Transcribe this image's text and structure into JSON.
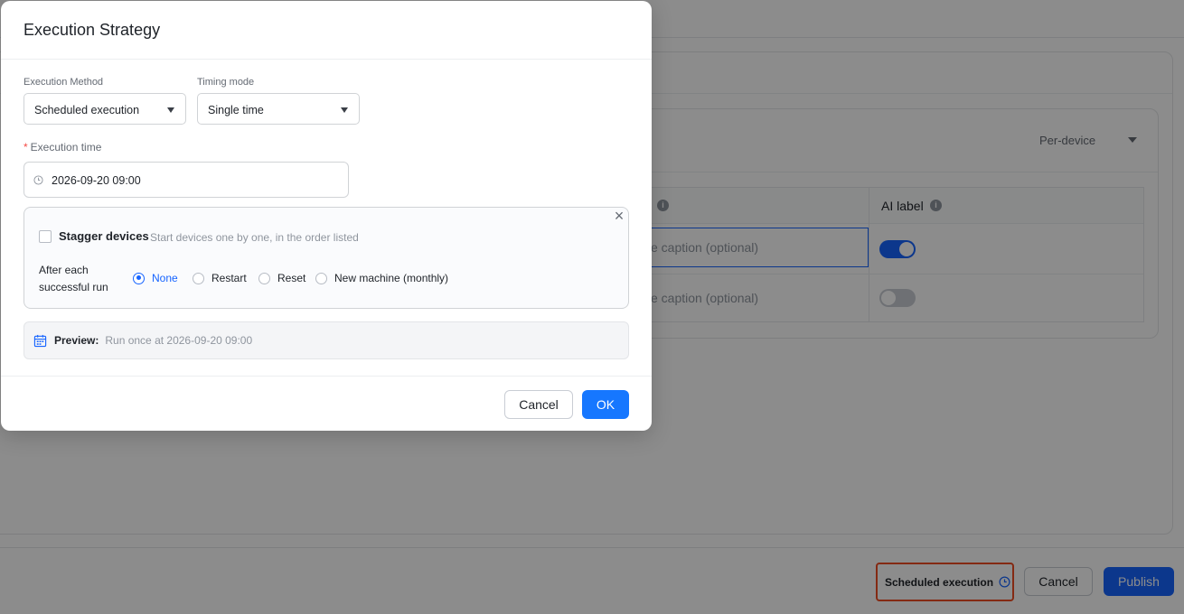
{
  "background": {
    "per_device_select": "Per-device",
    "table": {
      "col_ai_label": "AI label",
      "rows": [
        {
          "caption_placeholder": "e caption (optional)",
          "ai_label_on": true
        },
        {
          "caption_placeholder": "e caption (optional)",
          "ai_label_on": false
        }
      ]
    },
    "footer": {
      "scheduled_label": "Scheduled execution",
      "cancel_label": "Cancel",
      "publish_label": "Publish",
      "highlight_color": "#f04e23"
    }
  },
  "modal": {
    "title": "Execution Strategy",
    "execution_method": {
      "label": "Execution Method",
      "value": "Scheduled execution"
    },
    "timing_mode": {
      "label": "Timing mode",
      "value": "Single time"
    },
    "execution_time": {
      "required_mark": "*",
      "label": "Execution time",
      "value": "2026-09-20 09:00"
    },
    "stagger": {
      "title": "Stagger devices",
      "description": "Start devices one by one, in the order listed",
      "checked": false,
      "close_glyph": "×"
    },
    "after_run": {
      "label": "After each successful run",
      "options": [
        "None",
        "Restart",
        "Reset",
        "New machine (monthly)"
      ],
      "selected": "None"
    },
    "preview": {
      "label": "Preview:",
      "text": "Run once at 2026-09-20 09:00"
    },
    "buttons": {
      "cancel": "Cancel",
      "ok": "OK"
    },
    "accent_color": "#1677ff"
  }
}
